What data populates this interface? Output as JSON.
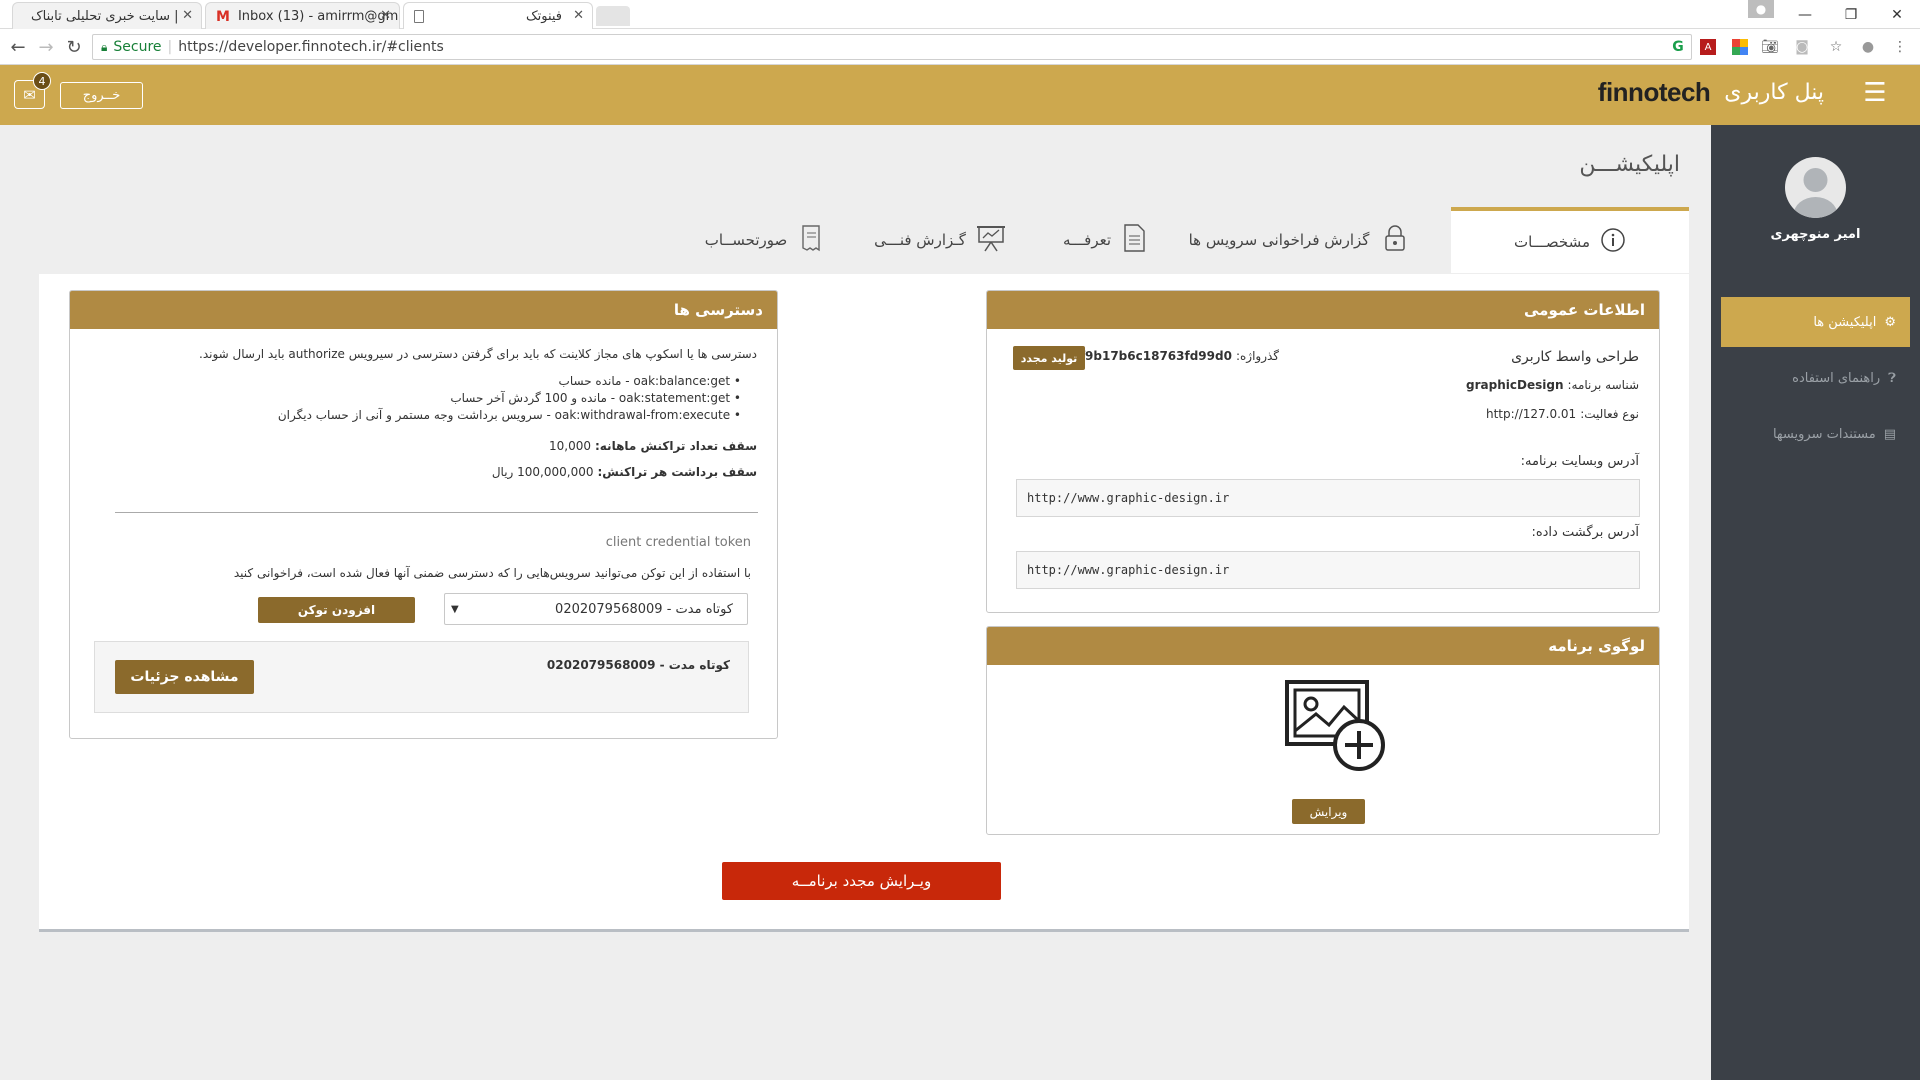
{
  "browser": {
    "tabs": [
      {
        "title": "سایت خبری تحلیلی تابناک |",
        "favicon": "tabnak-favicon",
        "active": false
      },
      {
        "title": "Inbox (13) - amirrm@gm",
        "favicon": "gmail-icon",
        "active": false
      },
      {
        "title": "فینوتک",
        "favicon": "page-icon",
        "active": true
      }
    ],
    "secure_label": "Secure",
    "url": "https://developer.finnotech.ir/#clients"
  },
  "header": {
    "brand_logo": "finnotech",
    "panel_title": "پنل کاربری",
    "logout_label": "خــروج",
    "mail_count": "4",
    "bg_color": "#cda84e"
  },
  "sidebar": {
    "username": "امیر منوچهری",
    "items": [
      {
        "label": "اپلیکیشن ها",
        "icon": "apps-icon",
        "active": true
      },
      {
        "label": "راهنمای استفاده",
        "icon": "help-icon",
        "active": false
      },
      {
        "label": "مستندات سرویسها",
        "icon": "document-icon",
        "active": false
      }
    ]
  },
  "main": {
    "page_title": "اپلیکیشـــن",
    "tabs": [
      {
        "label": "مشخصـــات",
        "icon": "info-icon",
        "active": true
      },
      {
        "label": "گزارش فراخوانی سرویس ها",
        "icon": "lock-icon",
        "active": false
      },
      {
        "label": "تعرفـــه",
        "icon": "document-icon",
        "active": false
      },
      {
        "label": "گـزارش فنـــی",
        "icon": "presentation-icon",
        "active": false
      },
      {
        "label": "صورتحســاب",
        "icon": "receipt-icon",
        "active": false
      }
    ]
  },
  "general": {
    "title": "اطلاعات عمومی",
    "app_name": "طراحی واسط کاربری",
    "password_label": "گذرواژه:",
    "password_value": "ef9b17b6c18763fd99d0",
    "regenerate_label": "تولید مجدد",
    "app_id_label": "شناسه برنامه:",
    "app_id_value": "graphicDesign",
    "activity_label": "نوع فعالیت:",
    "activity_value": "http://127.0.01",
    "website_label": "آدرس وبسایت برنامه:",
    "website_value": "http://www.graphic-design.ir",
    "callback_label": "آدرس برگشت داده:",
    "callback_value": "http://www.graphic-design.ir"
  },
  "logo_card": {
    "title": "لوگوی برنامه",
    "edit_label": "ویرایش"
  },
  "access": {
    "title": "دسترسی ها",
    "description": "دسترسی ها یا اسکوپ های مجاز کلاینت که باید برای گرفتن دسترسی در سیرویس authorize باید ارسال شوند.",
    "scopes": [
      {
        "code": "oak:balance:get",
        "desc": "- مانده حساب"
      },
      {
        "code": "oak:statement:get",
        "desc": "- مانده و 100 گردش آخر حساب"
      },
      {
        "code": "oak:withdrawal-from:execute",
        "desc": "- سرویس برداشت وجه مستمر و آنی از حساب دیگران"
      }
    ],
    "monthly_limit_label": "سقف تعداد تراکنش ماهانه:",
    "monthly_limit_value": "10,000",
    "per_tx_limit_label": "سقف برداشت هر تراکنش:",
    "per_tx_limit_value": "100,000,000 ریال",
    "token_title": "client credential token",
    "token_desc": "با استفاده از این توکن می‌توانید سرویس‌هایی را که دسترسی ضمنی آنها فعال شده است، فراخوانی کنید",
    "token_select_value": "کوتاه مدت - 0202079568009",
    "add_token_label": "افزودن توکن",
    "token_item": "کوتاه مدت - 0202079568009",
    "details_label": "مشاهده جزئیات"
  },
  "reedit_label": "ویـرایش مجدد برنامــه"
}
